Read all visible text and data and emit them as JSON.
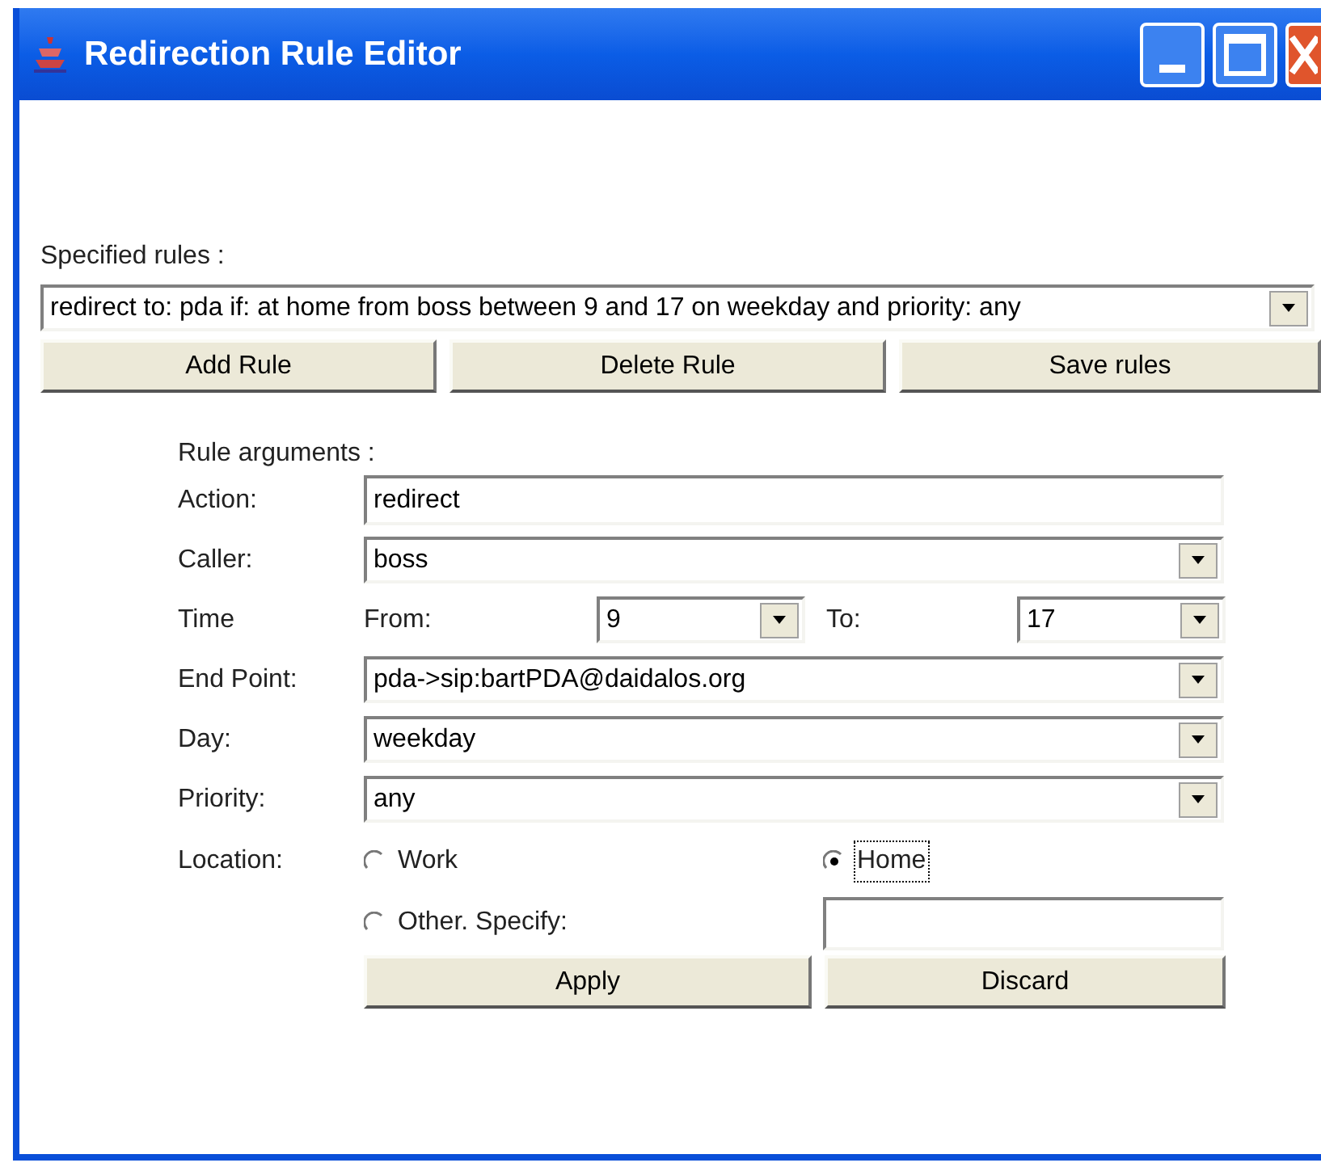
{
  "window": {
    "title": "Redirection Rule Editor"
  },
  "specified_rules": {
    "label": "Specified rules :",
    "value": "redirect to: pda if: at home from boss between 9 and 17 on weekday and priority: any"
  },
  "rule_buttons": [
    "Add Rule",
    "Delete Rule",
    "Save rules"
  ],
  "rule_arguments": {
    "heading": "Rule arguments :",
    "action": {
      "label": "Action:",
      "value": "redirect"
    },
    "caller": {
      "label": "Caller:",
      "value": "boss"
    },
    "time": {
      "label": "Time",
      "from_label": "From:",
      "from_value": "9",
      "to_label": "To:",
      "to_value": "17"
    },
    "end_point": {
      "label": "End Point:",
      "value": "pda->sip:bartPDA@daidalos.org"
    },
    "day": {
      "label": "Day:",
      "value": "weekday"
    },
    "priority": {
      "label": "Priority:",
      "value": "any"
    },
    "location": {
      "label": "Location:",
      "options": [
        {
          "label": "Work",
          "selected": false,
          "focused": false
        },
        {
          "label": "Home",
          "selected": true,
          "focused": true
        },
        {
          "label": "Other. Specify:",
          "selected": false,
          "focused": false
        }
      ]
    }
  },
  "form_buttons": [
    "Apply",
    "Discard"
  ]
}
